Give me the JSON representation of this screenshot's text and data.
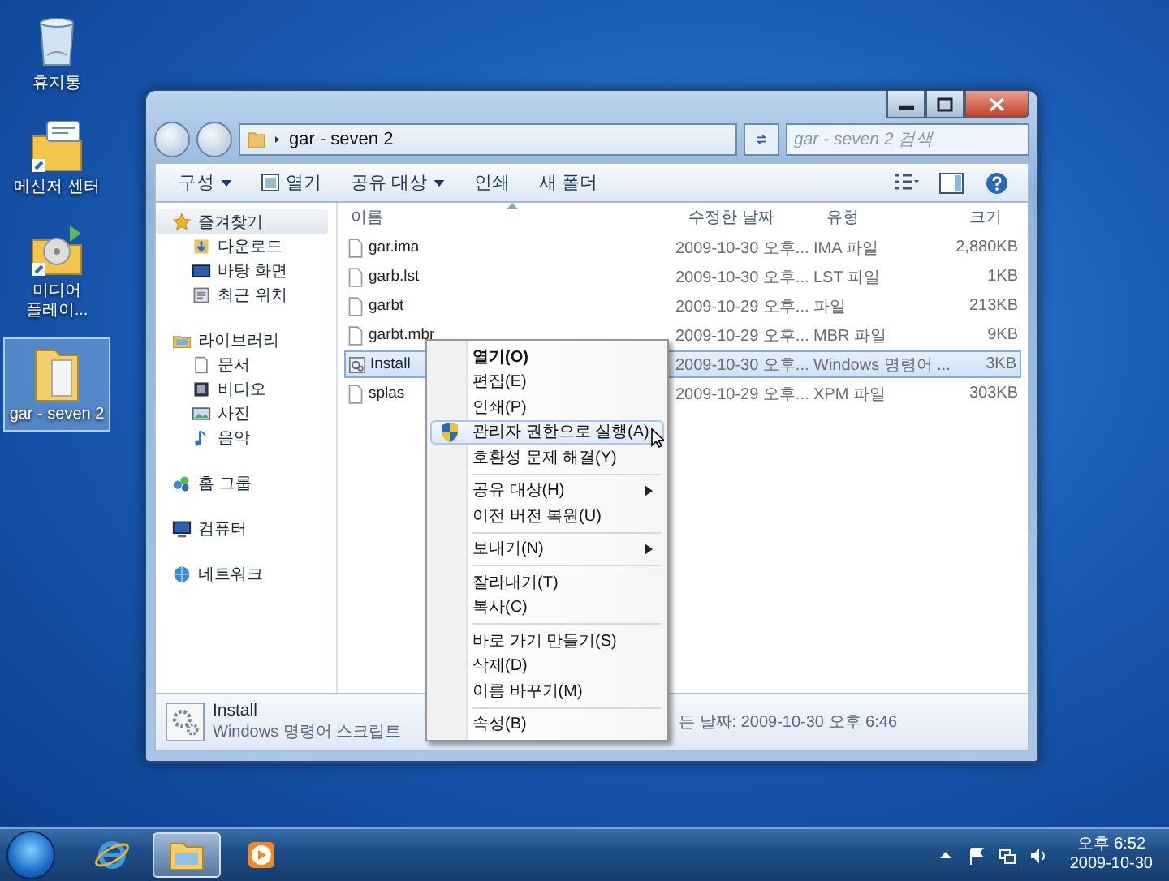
{
  "desktop_icons": [
    {
      "label": "휴지통",
      "kind": "bin",
      "selected": false
    },
    {
      "label": "메신저 센터",
      "kind": "messenger",
      "selected": false
    },
    {
      "label": "미디어 플레이...",
      "kind": "media",
      "selected": false
    },
    {
      "label": "gar - seven 2",
      "kind": "folder",
      "selected": true
    }
  ],
  "address": {
    "path": "gar - seven 2"
  },
  "search": {
    "placeholder": "gar - seven 2 검색"
  },
  "toolbar": [
    {
      "label": "구성",
      "kind": "text",
      "dropdown": true
    },
    {
      "label": "열기",
      "kind": "icon",
      "dropdown": false
    },
    {
      "label": "공유 대상",
      "kind": "text",
      "dropdown": true
    },
    {
      "label": "인쇄",
      "kind": "text",
      "dropdown": false
    },
    {
      "label": "새 폴더",
      "kind": "text",
      "dropdown": false
    }
  ],
  "sidebar": [
    {
      "label": "즐겨찾기",
      "kind": "star",
      "selected": true,
      "children": [
        {
          "label": "다운로드",
          "kind": "download",
          "selected": false
        },
        {
          "label": "바탕 화면",
          "kind": "desktop",
          "selected": false
        },
        {
          "label": "최근 위치",
          "kind": "recent",
          "selected": false
        }
      ]
    },
    {
      "label": "라이브러리",
      "kind": "library",
      "selected": false,
      "children": [
        {
          "label": "문서",
          "kind": "document",
          "selected": false
        },
        {
          "label": "비디오",
          "kind": "video",
          "selected": false
        },
        {
          "label": "사진",
          "kind": "picture",
          "selected": false
        },
        {
          "label": "음악",
          "kind": "music",
          "selected": false
        }
      ]
    },
    {
      "label": "홈 그룹",
      "kind": "homegroup",
      "selected": false
    },
    {
      "label": "컴퓨터",
      "kind": "computer",
      "selected": false
    },
    {
      "label": "네트워크",
      "kind": "network",
      "selected": false
    }
  ],
  "files": {
    "columns": [
      {
        "label": "이름",
        "sorted": true
      },
      {
        "label": "수정한 날짜",
        "sorted": false
      },
      {
        "label": "유형",
        "sorted": false
      },
      {
        "label": "크기",
        "sorted": false
      }
    ],
    "rows": [
      {
        "name": "gar.ima",
        "date": "2009-10-30 오후...",
        "type": "IMA 파일",
        "size": "2,880KB",
        "kind": "file",
        "selected": false
      },
      {
        "name": "garb.lst",
        "date": "2009-10-30 오후...",
        "type": "LST 파일",
        "size": "1KB",
        "kind": "file",
        "selected": false
      },
      {
        "name": "garbt",
        "date": "2009-10-29 오후...",
        "type": "파일",
        "size": "213KB",
        "kind": "file",
        "selected": false
      },
      {
        "name": "garbt.mbr",
        "date": "2009-10-29 오후...",
        "type": "MBR 파일",
        "size": "9KB",
        "kind": "file",
        "selected": false
      },
      {
        "name": "Install",
        "date": "2009-10-30 오후...",
        "type": "Windows 명령어 ...",
        "size": "3KB",
        "kind": "script",
        "selected": true
      },
      {
        "name": "splas",
        "date": "2009-10-29 오후...",
        "type": "XPM 파일",
        "size": "303KB",
        "kind": "file",
        "selected": false
      }
    ]
  },
  "context_menu": [
    {
      "kind": "item",
      "label": "열기(O)",
      "default": true,
      "submenu": false,
      "selected": false
    },
    {
      "kind": "item",
      "label": "편집(E)",
      "default": false,
      "submenu": false,
      "selected": false
    },
    {
      "kind": "item",
      "label": "인쇄(P)",
      "default": false,
      "submenu": false,
      "selected": false
    },
    {
      "kind": "admin",
      "label": "관리자 권한으로 실행(A)",
      "default": false,
      "submenu": false,
      "selected": true
    },
    {
      "kind": "item",
      "label": "호환성 문제 해결(Y)",
      "default": false,
      "submenu": false,
      "selected": false
    },
    {
      "kind": "separator"
    },
    {
      "kind": "item",
      "label": "공유 대상(H)",
      "default": false,
      "submenu": true,
      "selected": false
    },
    {
      "kind": "item",
      "label": "이전 버전 복원(U)",
      "default": false,
      "submenu": false,
      "selected": false
    },
    {
      "kind": "separator"
    },
    {
      "kind": "item",
      "label": "보내기(N)",
      "default": false,
      "submenu": true,
      "selected": false
    },
    {
      "kind": "separator"
    },
    {
      "kind": "item",
      "label": "잘라내기(T)",
      "default": false,
      "submenu": false,
      "selected": false
    },
    {
      "kind": "item",
      "label": "복사(C)",
      "default": false,
      "submenu": false,
      "selected": false
    },
    {
      "kind": "separator"
    },
    {
      "kind": "item",
      "label": "바로 가기 만들기(S)",
      "default": false,
      "submenu": false,
      "selected": false
    },
    {
      "kind": "item",
      "label": "삭제(D)",
      "default": false,
      "submenu": false,
      "selected": false
    },
    {
      "kind": "item",
      "label": "이름 바꾸기(M)",
      "default": false,
      "submenu": false,
      "selected": false
    },
    {
      "kind": "separator"
    },
    {
      "kind": "item",
      "label": "속성(B)",
      "default": false,
      "submenu": false,
      "selected": false
    }
  ],
  "details": {
    "name": "Install",
    "type": "Windows 명령어 스크립트",
    "date": "든 날짜: 2009-10-30 오후 6:46"
  },
  "taskbar": {
    "apps": [
      {
        "kind": "ie",
        "active": false
      },
      {
        "kind": "explorer",
        "active": true
      },
      {
        "kind": "media",
        "active": false
      }
    ],
    "clock": {
      "time": "오후 6:52",
      "date": "2009-10-30"
    }
  }
}
